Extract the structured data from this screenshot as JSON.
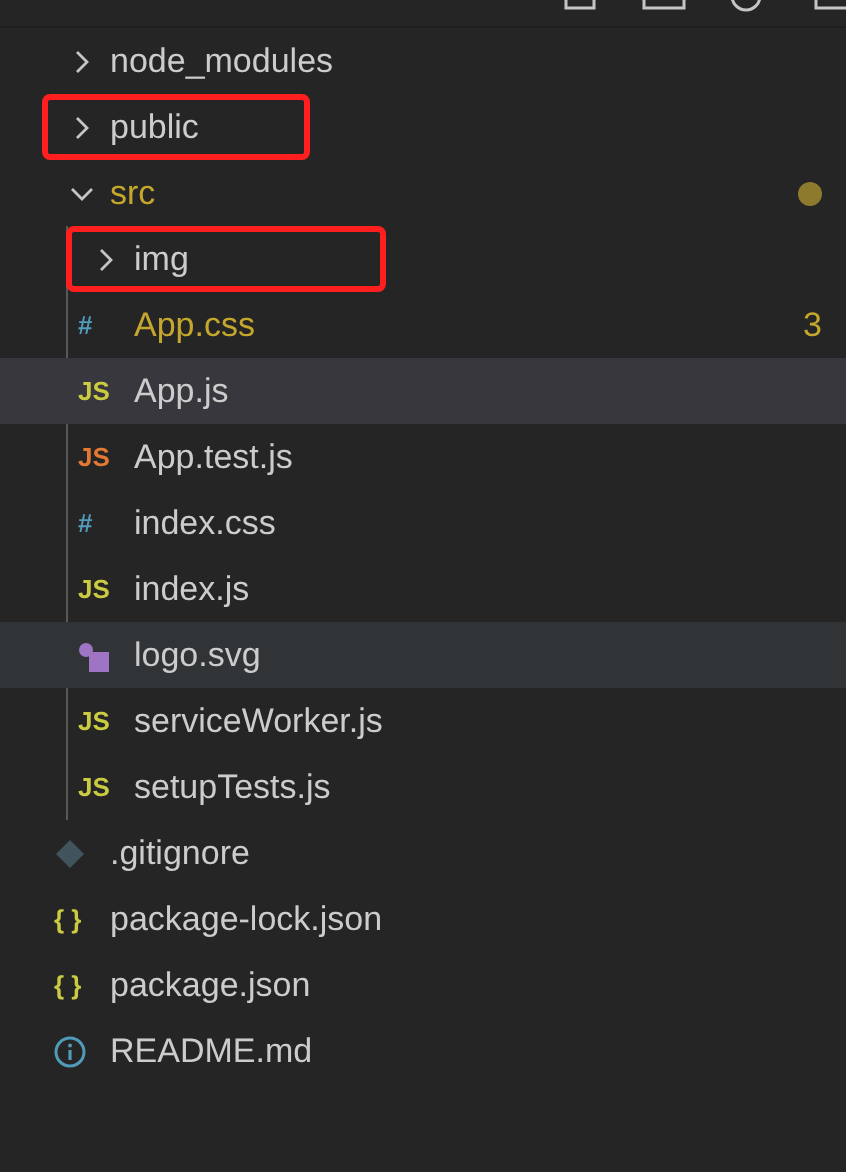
{
  "tree": [
    {
      "name": "node_modules",
      "kind": "folder",
      "expanded": false,
      "selected": false,
      "hovered": false,
      "modified": false,
      "annotated": false
    },
    {
      "name": "public",
      "kind": "folder",
      "expanded": false,
      "selected": false,
      "hovered": false,
      "modified": false,
      "annotated": true
    },
    {
      "name": "src",
      "kind": "folder",
      "expanded": true,
      "selected": false,
      "hovered": false,
      "modified": true,
      "annotated": false,
      "children": [
        {
          "name": "img",
          "kind": "folder",
          "expanded": false,
          "selected": false,
          "hovered": false,
          "modified": false,
          "annotated": true
        },
        {
          "name": "App.css",
          "kind": "css",
          "icon": "#",
          "selected": false,
          "hovered": false,
          "modified": true,
          "annotated": false,
          "badge": "3"
        },
        {
          "name": "App.js",
          "kind": "js",
          "icon": "JS",
          "selected": true,
          "hovered": false,
          "modified": false,
          "annotated": false
        },
        {
          "name": "App.test.js",
          "kind": "test",
          "icon": "JS",
          "selected": false,
          "hovered": false,
          "modified": false,
          "annotated": false
        },
        {
          "name": "index.css",
          "kind": "css",
          "icon": "#",
          "selected": false,
          "hovered": false,
          "modified": false,
          "annotated": false
        },
        {
          "name": "index.js",
          "kind": "js",
          "icon": "JS",
          "selected": false,
          "hovered": false,
          "modified": false,
          "annotated": false
        },
        {
          "name": "logo.svg",
          "kind": "svg",
          "selected": false,
          "hovered": true,
          "modified": false,
          "annotated": false
        },
        {
          "name": "serviceWorker.js",
          "kind": "js",
          "icon": "JS",
          "selected": false,
          "hovered": false,
          "modified": false,
          "annotated": false
        },
        {
          "name": "setupTests.js",
          "kind": "js",
          "icon": "JS",
          "selected": false,
          "hovered": false,
          "modified": false,
          "annotated": false
        }
      ]
    },
    {
      "name": ".gitignore",
      "kind": "git",
      "selected": false,
      "hovered": false,
      "modified": false,
      "annotated": false
    },
    {
      "name": "package-lock.json",
      "kind": "json",
      "icon": "{ }",
      "selected": false,
      "hovered": false,
      "modified": false,
      "annotated": false
    },
    {
      "name": "package.json",
      "kind": "json",
      "icon": "{ }",
      "selected": false,
      "hovered": false,
      "modified": false,
      "annotated": false
    },
    {
      "name": "README.md",
      "kind": "info",
      "selected": false,
      "hovered": false,
      "modified": false,
      "annotated": false
    }
  ]
}
